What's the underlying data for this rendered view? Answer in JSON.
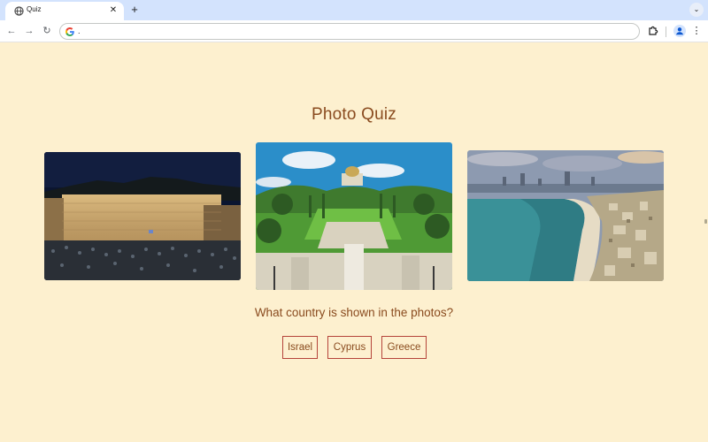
{
  "browser": {
    "tab_title": "Quiz",
    "tab_close": "✕",
    "new_tab": "+",
    "tab_menu": "⌄",
    "back": "←",
    "forward": "→",
    "reload": "↻",
    "url": ".",
    "menu": "⋮"
  },
  "page": {
    "title": "Photo Quiz",
    "question": "What country is shown in the photos?",
    "answers": [
      "Israel",
      "Cyprus",
      "Greece"
    ]
  },
  "colors": {
    "background": "#fdf0cf",
    "text": "#8a4b1f",
    "button_border": "#b5443a"
  }
}
